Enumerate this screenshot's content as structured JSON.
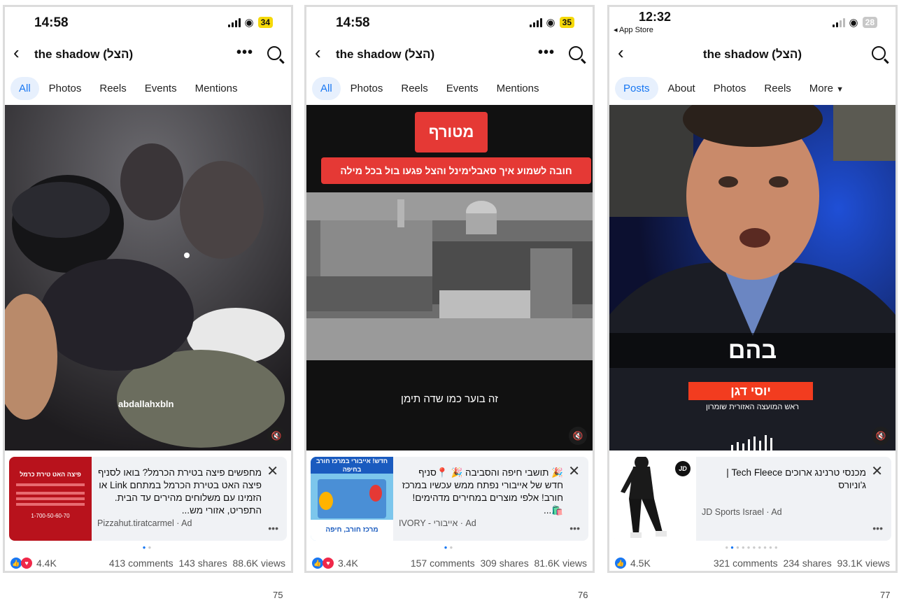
{
  "screens": [
    {
      "time": "14:58",
      "battery": "34",
      "title": "the shadow (הצל)",
      "more_dots": "•••",
      "tabs": [
        "All",
        "Photos",
        "Reels",
        "Events",
        "Mentions"
      ],
      "media_caption": "abdallahxbln",
      "ad": {
        "text": "מחפשים פיצה בטירת הכרמל? בואו לסניף פיצה האט בטירת הכרמל במתחם Link או הזמינו עם משלוחים מהירים עד הבית. התפריט, אזורי מש...",
        "source": "Pizzahut.tiratcarmel · Ad",
        "image_headline": "פיצה האט טירת כרמל",
        "image_phone": "1-700-50-60-70"
      },
      "reactions": "4.4K",
      "comments": "413 comments",
      "shares": "143 shares",
      "views": "88.6K views",
      "page_number": "75"
    },
    {
      "time": "14:58",
      "battery": "35",
      "title": "the shadow (הצל)",
      "more_dots": "•••",
      "tabs": [
        "All",
        "Photos",
        "Reels",
        "Events",
        "Mentions"
      ],
      "media_badge": "מטורף",
      "media_subtitle": "חובה לשמוע איך סאבלימינל והצל פגעו בול בכל מילה",
      "media_caption": "זה בוער כמו שדה תימן",
      "ad": {
        "text": "🎉 תושבי חיפה והסביבה 🎉 📍סניף חדש של אייבורי נפתח ממש עכשיו במרכז חורב! אלפי מוצרים במחירים מדהימים! 🛍️...",
        "source": "IVORY - אייבורי · Ad",
        "image_headline": "חדש! אייבורי במרכז חורב בחיפה",
        "image_footer": "מרכז חורב, חיפה"
      },
      "reactions": "3.4K",
      "comments": "157 comments",
      "shares": "309 shares",
      "views": "81.6K views",
      "page_number": "76"
    },
    {
      "time": "12:32",
      "app_store_back": "◂ App Store",
      "battery": "28",
      "title": "the shadow (הצל)",
      "tabs": [
        "Posts",
        "About",
        "Photos",
        "Reels",
        "More"
      ],
      "media_word": "בהם",
      "media_name": "יוסי דגן",
      "media_role": "ראש המועצה האזורית שומרון",
      "ad": {
        "text": "מכנסי טרנינג ארוכים Tech Fleece | ג'וניורס",
        "source": "JD Sports Israel · Ad",
        "logo": "JD"
      },
      "reactions": "4.5K",
      "comments": "321 comments",
      "shares": "234 shares",
      "views": "93.1K views",
      "page_number": "77"
    }
  ],
  "colors": {
    "facebook_blue": "#1877f2",
    "love_red": "#f02849",
    "battery_yellow": "#f5d90a",
    "tab_active_bg": "#e7f0fd"
  }
}
